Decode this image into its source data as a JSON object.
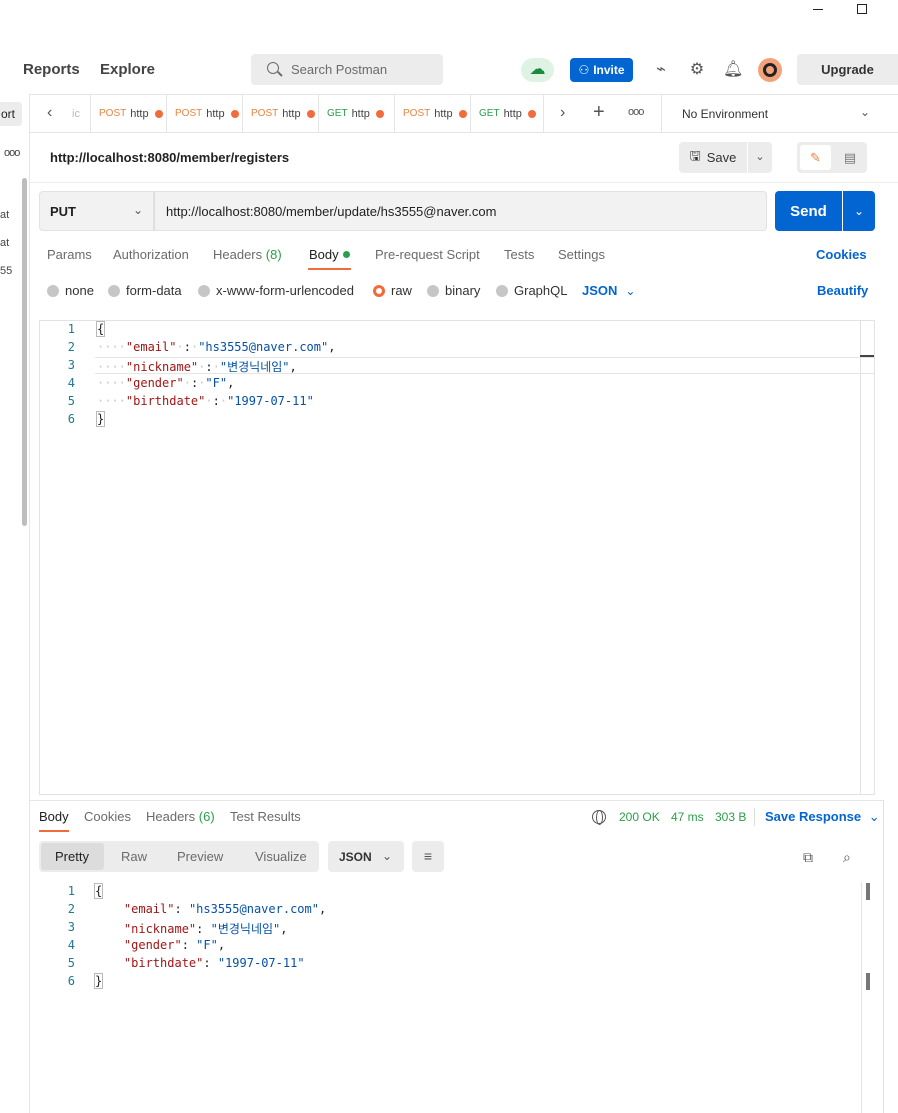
{
  "window": {
    "minimize_label": "",
    "maximize_label": ""
  },
  "header": {
    "nav": [
      "Reports",
      "Explore"
    ],
    "search_placeholder": "Search Postman",
    "invite_label": "Invite",
    "upgrade_label": "Upgrade",
    "icons": [
      "cloud-sync-icon",
      "satellite-icon",
      "gear-icon",
      "bell-icon",
      "avatar"
    ]
  },
  "sidebar": {
    "button_label": "ort",
    "more": "ooo",
    "items": [
      "at",
      "at",
      "55"
    ]
  },
  "tabs": {
    "items": [
      {
        "method": "",
        "url": "ic"
      },
      {
        "method": "POST",
        "url": "http"
      },
      {
        "method": "POST",
        "url": "http"
      },
      {
        "method": "POST",
        "url": "http"
      },
      {
        "method": "GET",
        "url": "http"
      },
      {
        "method": "POST",
        "url": "http"
      },
      {
        "method": "GET",
        "url": "http"
      }
    ],
    "more": "ooo",
    "environment": "No Environment"
  },
  "request": {
    "title": "http://localhost:8080/member/registers",
    "save_label": "Save",
    "method": "PUT",
    "url": "http://localhost:8080/member/update/hs3555@naver.com",
    "send_label": "Send",
    "tabs": {
      "params": "Params",
      "authorization": "Authorization",
      "headers": "Headers",
      "headers_count": "(8)",
      "body": "Body",
      "prerequest": "Pre-request Script",
      "tests": "Tests",
      "settings": "Settings"
    },
    "cookies_label": "Cookies",
    "body_types": [
      "none",
      "form-data",
      "x-www-form-urlencoded",
      "raw",
      "binary",
      "GraphQL"
    ],
    "selected_body_type": "raw",
    "language": "JSON",
    "beautify_label": "Beautify",
    "line_numbers": [
      "1",
      "2",
      "3",
      "4",
      "5",
      "6"
    ],
    "json": {
      "open": "{",
      "close": "}",
      "fields": [
        {
          "key": "\"email\"",
          "value": "\"hs3555@naver.com\"",
          "comma": ","
        },
        {
          "key": "\"nickname\"",
          "value": "\"변경닉네임\"",
          "comma": ","
        },
        {
          "key": "\"gender\"",
          "value": "\"F\"",
          "comma": ","
        },
        {
          "key": "\"birthdate\"",
          "value": "\"1997-07-11\"",
          "comma": ""
        }
      ]
    }
  },
  "response": {
    "tabs": {
      "body": "Body",
      "cookies": "Cookies",
      "headers": "Headers",
      "headers_count": "(6)",
      "test_results": "Test Results"
    },
    "status": "200 OK",
    "time": "47 ms",
    "size": "303 B",
    "save_label": "Save Response",
    "formats": [
      "Pretty",
      "Raw",
      "Preview",
      "Visualize"
    ],
    "language": "JSON",
    "line_numbers": [
      "1",
      "2",
      "3",
      "4",
      "5",
      "6"
    ],
    "json": {
      "open": "{",
      "close": "}",
      "fields": [
        {
          "key": "\"email\"",
          "value": "\"hs3555@naver.com\"",
          "comma": ","
        },
        {
          "key": "\"nickname\"",
          "value": "\"변경닉네임\"",
          "comma": ","
        },
        {
          "key": "\"gender\"",
          "value": "\"F\"",
          "comma": ","
        },
        {
          "key": "\"birthdate\"",
          "value": "\"1997-07-11\"",
          "comma": ""
        }
      ]
    }
  },
  "colors": {
    "accent_orange": "#f26b3a",
    "brand_blue": "#0265d2",
    "success_green": "#2a9e4a",
    "json_key": "#a31515",
    "json_string": "#0451a5"
  }
}
